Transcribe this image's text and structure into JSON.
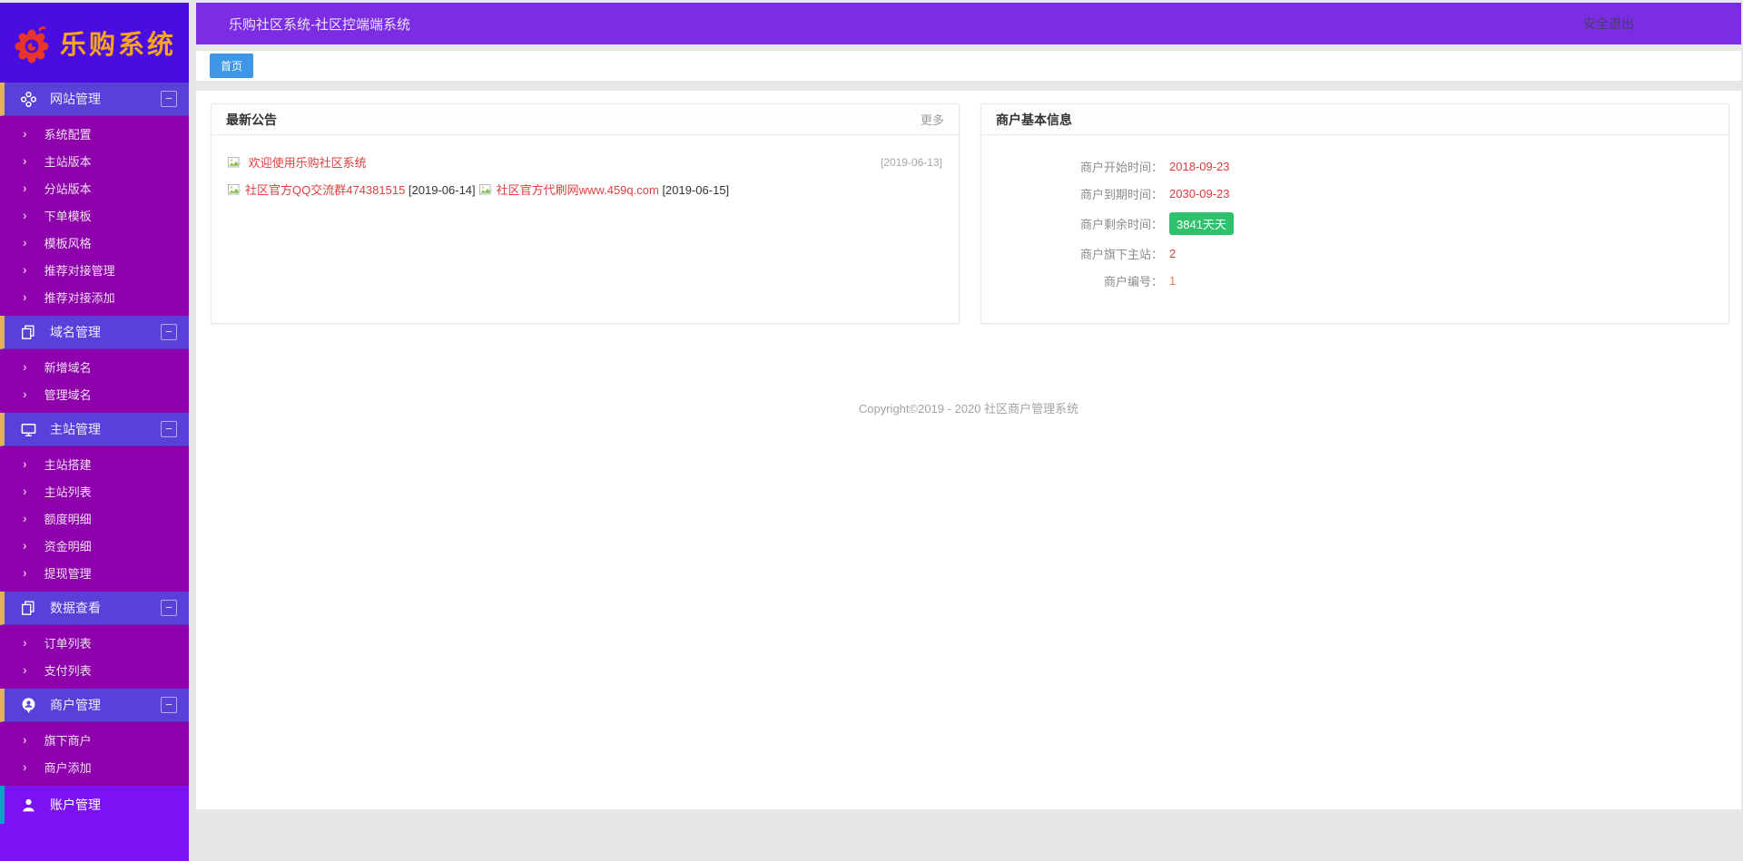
{
  "colors": {
    "sidebar_base": "#7c11f2",
    "logo_bg": "#4a0de0",
    "section_header_bg": "#5b3fd9",
    "submenu_bg": "#8d00ab",
    "topbar_bg": "#7c2ce2",
    "gold_accent": "#e2b25c",
    "teal_accent": "#0d9fc8",
    "tab_blue": "#3e97e6",
    "link_red": "#e03e3e",
    "badge_green": "#2dc26b"
  },
  "logo": {
    "brand_text": "乐购系统"
  },
  "topbar": {
    "title": "乐购社区系统-社区控端端系统",
    "logout_label": "安全退出"
  },
  "tabs": {
    "home_label": "首页"
  },
  "sidebar": {
    "collapse_glyph": "−",
    "chevron_glyph": "›",
    "sections": [
      {
        "label": "网站管理",
        "icon": "clover-icon",
        "items": [
          "系统配置",
          "主站版本",
          "分站版本",
          "下单模板",
          "模板风格",
          "推荐对接管理",
          "推荐对接添加"
        ]
      },
      {
        "label": "域名管理",
        "icon": "copy-icon",
        "items": [
          "新增域名",
          "管理域名"
        ]
      },
      {
        "label": "主站管理",
        "icon": "monitor-icon",
        "items": [
          "主站搭建",
          "主站列表",
          "额度明细",
          "资金明细",
          "提现管理"
        ]
      },
      {
        "label": "数据查看",
        "icon": "copy-icon",
        "items": [
          "订单列表",
          "支付列表"
        ]
      },
      {
        "label": "商户管理",
        "icon": "person-pin-icon",
        "items": [
          "旗下商户",
          "商户添加"
        ]
      }
    ],
    "account_item": {
      "label": "账户管理",
      "icon": "user-icon"
    }
  },
  "announcements": {
    "title": "最新公告",
    "more_label": "更多",
    "row1": {
      "text": "欢迎使用乐购社区系统",
      "date": "[2019-06-13]"
    },
    "row2": [
      {
        "text": "社区官方QQ交流群474381515",
        "date": "[2019-06-14]"
      },
      {
        "text": "社区官方代刷网www.459q.com",
        "date": "[2019-06-15]"
      }
    ]
  },
  "merchant": {
    "title": "商户基本信息",
    "rows": [
      {
        "label": "商户开始时间：",
        "value": "2018-09-23",
        "type": "red"
      },
      {
        "label": "商户到期时间：",
        "value": "2030-09-23",
        "type": "red"
      },
      {
        "label": "商户剩余时间：",
        "value": "3841天天",
        "type": "badge"
      },
      {
        "label": "商户旗下主站：",
        "value": "2",
        "type": "red"
      },
      {
        "label": "商户编号：",
        "value": "1",
        "type": "orange"
      }
    ]
  },
  "footer": {
    "copyright": "Copyright©2019 - 2020 社区商户管理系统"
  }
}
